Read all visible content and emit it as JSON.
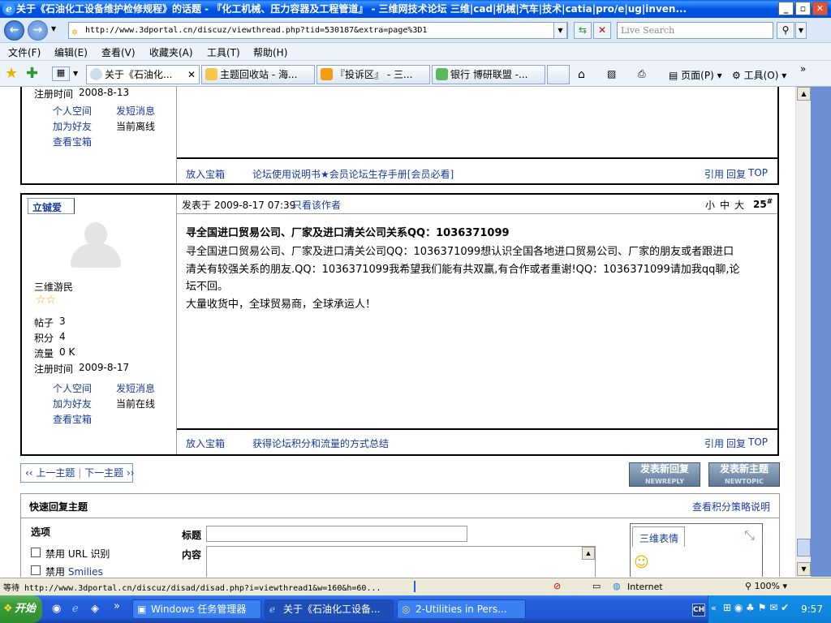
{
  "window": {
    "title": "关于《石油化工设备维护检修规程》的话题 - 『化工机械、压力容器及工程管道』 - 三维网技术论坛 三维|cad|机械|汽车|技术|catia|pro/e|ug|inven..."
  },
  "address": {
    "url": "http://www.3dportal.cn/discuz/viewthread.php?tid=530187&extra=page%3D1",
    "search_placeholder": "Live Search"
  },
  "menu": [
    "文件(F)",
    "编辑(E)",
    "查看(V)",
    "收藏夹(A)",
    "工具(T)",
    "帮助(H)"
  ],
  "tabs": [
    "关于《石油化...",
    "主题回收站 - 海...",
    "『投诉区』 - 三...",
    "银行 博研联盟 -..."
  ],
  "toolbar": {
    "page": "页面(P)",
    "tools": "工具(O)"
  },
  "post1": {
    "reg_label": "注册时间",
    "reg_date": "2008-8-13",
    "links": [
      "个人空间",
      "发短消息",
      "加为好友",
      "当前离线",
      "查看宝箱"
    ],
    "footer_left": "放入宝箱",
    "footer_sig": "论坛使用说明书★会员论坛生存手册[会员必看]",
    "footer_right": [
      "引用",
      "回复",
      "TOP"
    ]
  },
  "post2": {
    "username": "立铖爱",
    "rank": "三维游民",
    "stats": [
      {
        "k": "帖子",
        "v": "3"
      },
      {
        "k": "积分",
        "v": "4"
      },
      {
        "k": "流量",
        "v": "0 K"
      },
      {
        "k": "注册时间",
        "v": "2009-8-17"
      }
    ],
    "links": [
      "个人空间",
      "发短消息",
      "加为好友",
      "当前在线",
      "查看宝箱"
    ],
    "posted_label": "发表于 2009-8-17 07:39",
    "only_author": "只看该作者",
    "font_sizes": [
      "小",
      "中",
      "大"
    ],
    "floor": "25",
    "floor_mark": "#",
    "subject": "寻全国进口贸易公司、厂家及进口清关公司关系QQ：1036371099",
    "body_lines": [
      "寻全国进口贸易公司、厂家及进口清关公司QQ：1036371099想认识全国各地进口贸易公司、厂家的朋友或者跟进口",
      "清关有较强关系的朋友.QQ：1036371099我希望我们能有共双赢,有合作或者重谢!QQ：1036371099请加我qq聊,论",
      "坛不回。"
    ],
    "signature": "大量收货中，全球贸易商，全球承运人！",
    "footer_left": "放入宝箱",
    "footer_sig": "获得论坛积分和流量的方式总结",
    "footer_right": [
      "引用",
      "回复",
      "TOP"
    ]
  },
  "pager": {
    "prev": "‹‹ 上一主题",
    "next": "下一主题 ››"
  },
  "buttons": {
    "reply": "发表新回复",
    "reply_en": "NEWREPLY",
    "newtopic": "发表新主题",
    "newtopic_en": "NEWTOPIC"
  },
  "quick": {
    "title": "快速回复主题",
    "policy": "查看积分策略说明",
    "options": "选项",
    "disable_url": "禁用 URL 识别",
    "disable_smilies_pre": "禁用 ",
    "disable_smilies_link": "Smilies",
    "subject_label": "标题",
    "content_label": "内容",
    "emoticon_tab": "三维表情"
  },
  "status": {
    "text": "等待 http://www.3dportal.cn/discuz/disad/disad.php?i=viewthread1&w=160&h=60...",
    "zone": "Internet",
    "zoom": "100%"
  },
  "taskbar": {
    "start": "开始",
    "tasks": [
      "Windows 任务管理器",
      "关于《石油化工设备...",
      "2-Utilities in Pers..."
    ],
    "ime": "CH",
    "clock": "9:57"
  }
}
